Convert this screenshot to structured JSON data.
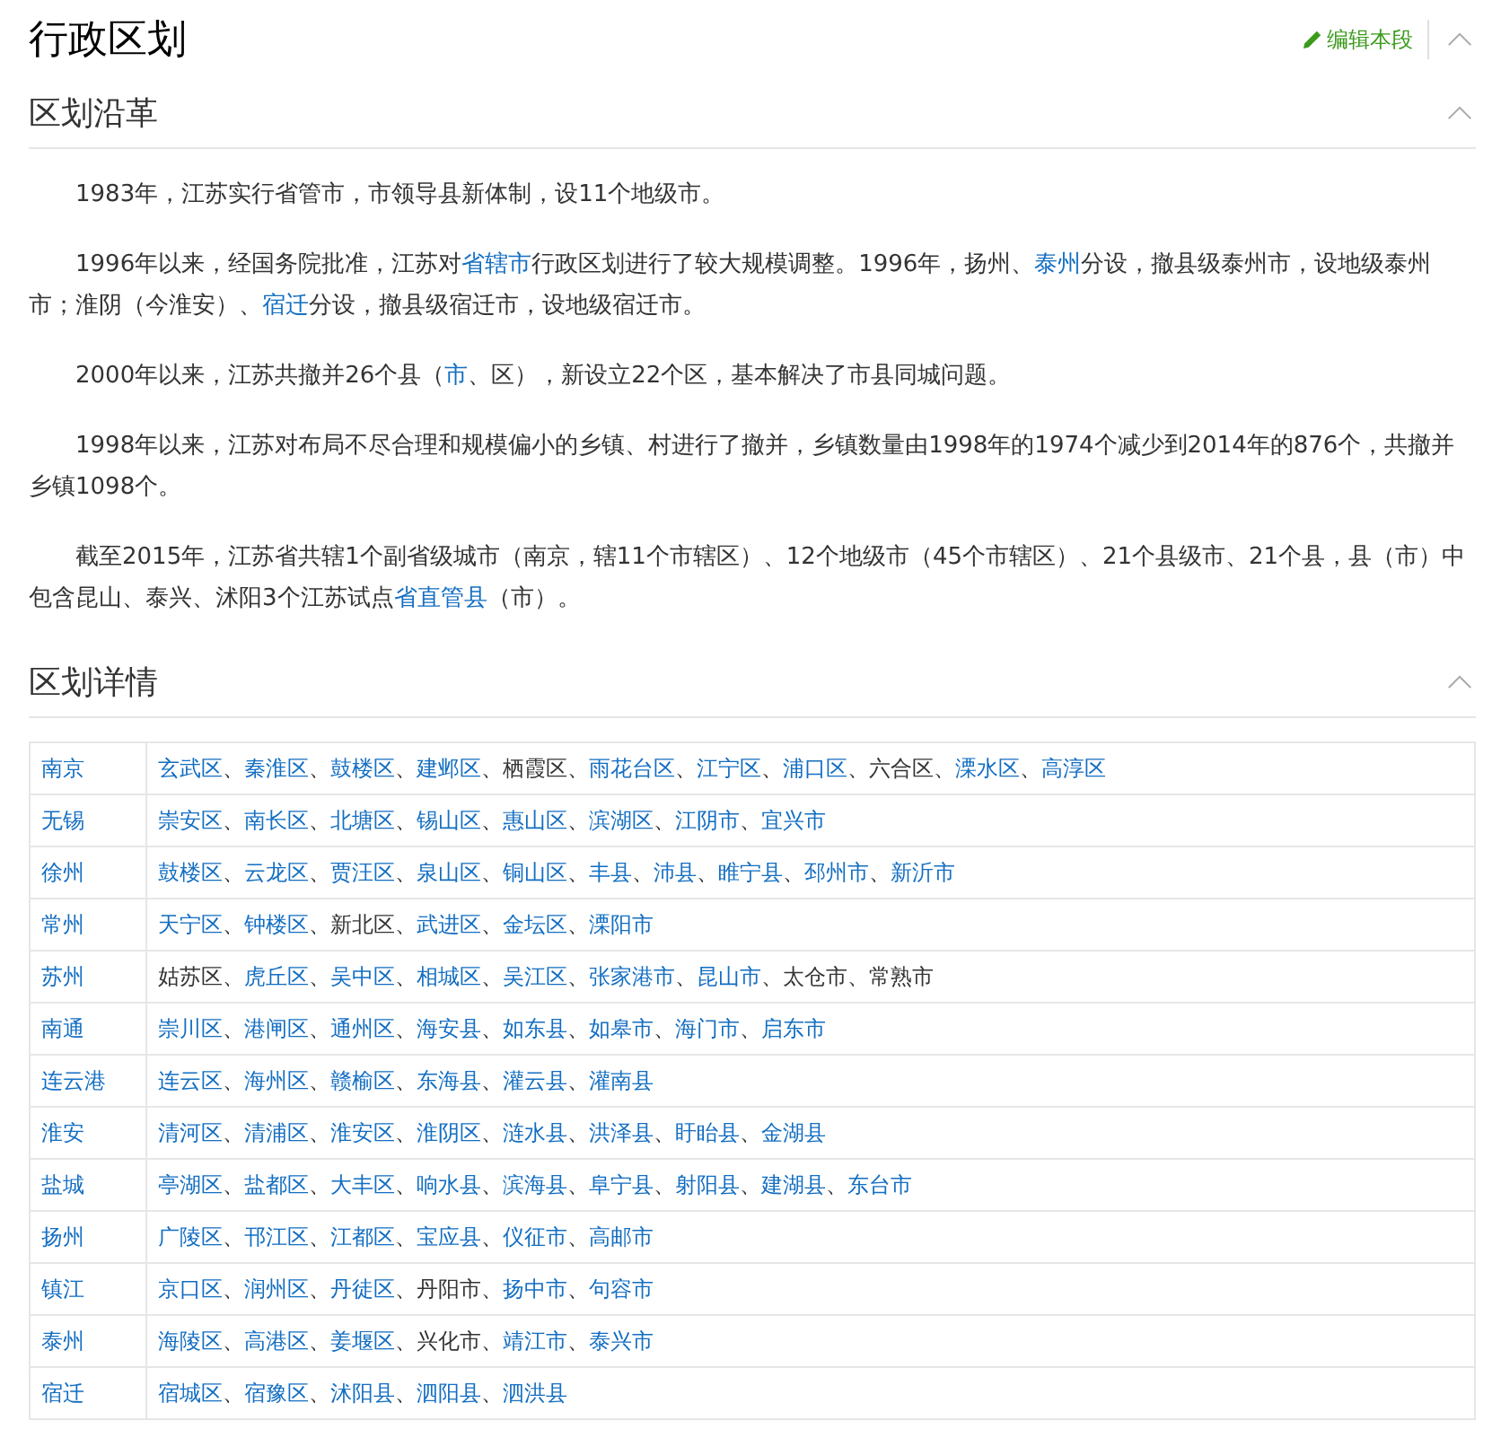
{
  "title": "行政区划",
  "edit_link": "编辑本段",
  "sections": [
    {
      "heading": "区划沿革",
      "expanded": true,
      "paragraphs": [
        [
          {
            "text": "1983年，江苏实行省管市，市领导县新体制，设11个地级市。",
            "link": false
          }
        ],
        [
          {
            "text": "1996年以来，经国务院批准，江苏对",
            "link": false
          },
          {
            "text": "省辖市",
            "link": true
          },
          {
            "text": "行政区划进行了较大规模调整。1996年，扬州、",
            "link": false
          },
          {
            "text": "泰州",
            "link": true
          },
          {
            "text": "分设，撤县级泰州市，设地级泰州市；淮阴（今淮安）、",
            "link": false
          },
          {
            "text": "宿迁",
            "link": true
          },
          {
            "text": "分设，撤县级宿迁市，设地级宿迁市。",
            "link": false
          }
        ],
        [
          {
            "text": "2000年以来，江苏共撤并26个县（",
            "link": false
          },
          {
            "text": "市",
            "link": true
          },
          {
            "text": "、区），新设立22个区，基本解决了市县同城问题。",
            "link": false
          }
        ],
        [
          {
            "text": "1998年以来，江苏对布局不尽合理和规模偏小的乡镇、村进行了撤并，乡镇数量由1998年的1974个减少到2014年的876个，共撤并乡镇1098个。",
            "link": false
          }
        ],
        [
          {
            "text": "截至2015年，江苏省共辖1个副省级城市（南京，辖11个市辖区）、12个地级市（45个市辖区）、21个县级市、21个县，县（市）中包含昆山、泰兴、沭阳3个江苏试点",
            "link": false
          },
          {
            "text": "省直管县",
            "link": true
          },
          {
            "text": "（市）。",
            "link": false
          }
        ]
      ]
    },
    {
      "heading": "区划详情",
      "expanded": true,
      "separator": "、",
      "rows": [
        {
          "city": "南京",
          "units": [
            {
              "name": "玄武区",
              "link": true
            },
            {
              "name": "秦淮区",
              "link": true
            },
            {
              "name": "鼓楼区",
              "link": true
            },
            {
              "name": "建邺区",
              "link": true
            },
            {
              "name": "栖霞区",
              "link": false
            },
            {
              "name": "雨花台区",
              "link": true
            },
            {
              "name": "江宁区",
              "link": true
            },
            {
              "name": "浦口区",
              "link": true
            },
            {
              "name": "六合区",
              "link": false
            },
            {
              "name": "溧水区",
              "link": true
            },
            {
              "name": "高淳区",
              "link": true
            }
          ]
        },
        {
          "city": "无锡",
          "units": [
            {
              "name": "崇安区",
              "link": true
            },
            {
              "name": "南长区",
              "link": true
            },
            {
              "name": "北塘区",
              "link": true
            },
            {
              "name": "锡山区",
              "link": true
            },
            {
              "name": "惠山区",
              "link": true
            },
            {
              "name": "滨湖区",
              "link": true
            },
            {
              "name": "江阴市",
              "link": true
            },
            {
              "name": "宜兴市",
              "link": true
            }
          ]
        },
        {
          "city": "徐州",
          "units": [
            {
              "name": "鼓楼区",
              "link": true
            },
            {
              "name": "云龙区",
              "link": true
            },
            {
              "name": "贾汪区",
              "link": true
            },
            {
              "name": "泉山区",
              "link": true
            },
            {
              "name": "铜山区",
              "link": true
            },
            {
              "name": "丰县",
              "link": true
            },
            {
              "name": "沛县",
              "link": true
            },
            {
              "name": "睢宁县",
              "link": true
            },
            {
              "name": "邳州市",
              "link": true
            },
            {
              "name": "新沂市",
              "link": true
            }
          ]
        },
        {
          "city": "常州",
          "units": [
            {
              "name": "天宁区",
              "link": true
            },
            {
              "name": "钟楼区",
              "link": true
            },
            {
              "name": "新北区",
              "link": false
            },
            {
              "name": "武进区",
              "link": true
            },
            {
              "name": "金坛区",
              "link": true
            },
            {
              "name": "溧阳市",
              "link": true
            }
          ]
        },
        {
          "city": "苏州",
          "units": [
            {
              "name": "姑苏区",
              "link": false
            },
            {
              "name": "虎丘区",
              "link": true
            },
            {
              "name": "吴中区",
              "link": true
            },
            {
              "name": "相城区",
              "link": true
            },
            {
              "name": "吴江区",
              "link": true
            },
            {
              "name": "张家港市",
              "link": true
            },
            {
              "name": "昆山市",
              "link": true
            },
            {
              "name": "太仓市",
              "link": false
            },
            {
              "name": "常熟市",
              "link": false
            }
          ]
        },
        {
          "city": "南通",
          "units": [
            {
              "name": "崇川区",
              "link": true
            },
            {
              "name": "港闸区",
              "link": true
            },
            {
              "name": "通州区",
              "link": true
            },
            {
              "name": "海安县",
              "link": true
            },
            {
              "name": "如东县",
              "link": true
            },
            {
              "name": "如皋市",
              "link": true
            },
            {
              "name": "海门市",
              "link": true
            },
            {
              "name": "启东市",
              "link": true
            }
          ]
        },
        {
          "city": "连云港",
          "units": [
            {
              "name": "连云区",
              "link": true
            },
            {
              "name": "海州区",
              "link": true
            },
            {
              "name": "赣榆区",
              "link": true
            },
            {
              "name": "东海县",
              "link": true
            },
            {
              "name": "灌云县",
              "link": true
            },
            {
              "name": "灌南县",
              "link": true
            }
          ]
        },
        {
          "city": "淮安",
          "units": [
            {
              "name": "清河区",
              "link": true
            },
            {
              "name": "清浦区",
              "link": true
            },
            {
              "name": "淮安区",
              "link": true
            },
            {
              "name": "淮阴区",
              "link": true
            },
            {
              "name": "涟水县",
              "link": true
            },
            {
              "name": "洪泽县",
              "link": true
            },
            {
              "name": "盱眙县",
              "link": true
            },
            {
              "name": "金湖县",
              "link": true
            }
          ]
        },
        {
          "city": "盐城",
          "units": [
            {
              "name": "亭湖区",
              "link": true
            },
            {
              "name": "盐都区",
              "link": true
            },
            {
              "name": "大丰区",
              "link": true
            },
            {
              "name": "响水县",
              "link": true
            },
            {
              "name": "滨海县",
              "link": true
            },
            {
              "name": "阜宁县",
              "link": true
            },
            {
              "name": "射阳县",
              "link": true
            },
            {
              "name": "建湖县",
              "link": true
            },
            {
              "name": "东台市",
              "link": true
            }
          ]
        },
        {
          "city": "扬州",
          "units": [
            {
              "name": "广陵区",
              "link": true
            },
            {
              "name": "邗江区",
              "link": true
            },
            {
              "name": "江都区",
              "link": true
            },
            {
              "name": "宝应县",
              "link": true
            },
            {
              "name": "仪征市",
              "link": true
            },
            {
              "name": "高邮市",
              "link": true
            }
          ]
        },
        {
          "city": "镇江",
          "units": [
            {
              "name": "京口区",
              "link": true
            },
            {
              "name": "润州区",
              "link": true
            },
            {
              "name": "丹徒区",
              "link": true
            },
            {
              "name": "丹阳市",
              "link": false
            },
            {
              "name": "扬中市",
              "link": true
            },
            {
              "name": "句容市",
              "link": true
            }
          ]
        },
        {
          "city": "泰州",
          "units": [
            {
              "name": "海陵区",
              "link": true
            },
            {
              "name": "高港区",
              "link": true
            },
            {
              "name": "姜堰区",
              "link": true
            },
            {
              "name": "兴化市",
              "link": false
            },
            {
              "name": "靖江市",
              "link": true
            },
            {
              "name": "泰兴市",
              "link": true
            }
          ]
        },
        {
          "city": "宿迁",
          "units": [
            {
              "name": "宿城区",
              "link": true
            },
            {
              "name": "宿豫区",
              "link": true
            },
            {
              "name": "沭阳县",
              "link": true
            },
            {
              "name": "泗阳县",
              "link": true
            },
            {
              "name": "泗洪县",
              "link": true
            }
          ]
        }
      ]
    }
  ]
}
